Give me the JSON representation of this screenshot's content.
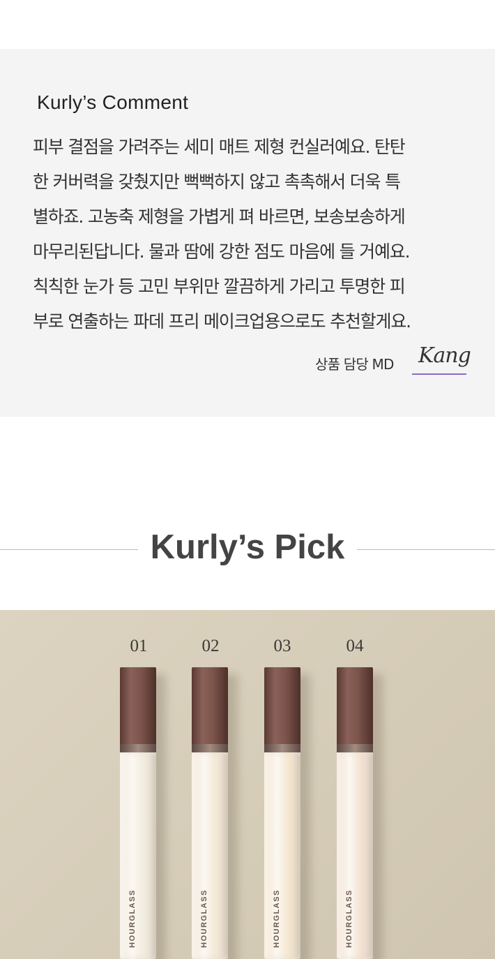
{
  "comment": {
    "title": "Kurly’s Comment",
    "lines": [
      "피부 결점을 가려주는 세미 매트 제형 컨실러예요. 탄탄",
      "한 커버력을 갖췄지만 뻑뻑하지 않고 촉촉해서 더욱 특",
      "별하죠. 고농축 제형을 가볍게 펴 바르면, 보송보송하게",
      "마무리된답니다. 물과 땀에 강한 점도 마음에 들 거예요.",
      "칙칙한 눈가 등 고민 부위만 깔끔하게 가리고 투명한 피",
      "부로 연출하는 파데 프리 메이크업용으로도 추천할게요."
    ],
    "md_label": "상품 담당 MD",
    "md_name": "Kang",
    "signature_underline_color": "#8c6bc8"
  },
  "pick": {
    "title": "Kurly’s Pick"
  },
  "products": [
    {
      "number": "01",
      "brand": "HOURGLASS",
      "shade_color": "#f1eadc"
    },
    {
      "number": "02",
      "brand": "HOURGLASS",
      "shade_color": "#f3e6d4"
    },
    {
      "number": "03",
      "brand": "HOURGLASS",
      "shade_color": "#f4e4cc"
    },
    {
      "number": "04",
      "brand": "HOURGLASS",
      "shade_color": "#f3dfd0"
    }
  ]
}
